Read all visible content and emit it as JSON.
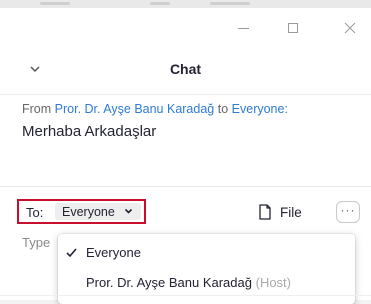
{
  "window": {
    "title": "Chat",
    "controls": [
      "minimize",
      "maximize",
      "close"
    ]
  },
  "message": {
    "prefix": "From",
    "sender": "Pror. Dr. Ayşe Banu Karadağ",
    "connector": "to",
    "recipient": "Everyone:",
    "text": "Merhaba Arkadaşlar"
  },
  "composer": {
    "to_label": "To:",
    "to_value": "Everyone",
    "file_label": "File",
    "more_label": "···",
    "placeholder": "Type"
  },
  "recipient_menu": {
    "items": [
      {
        "name": "Everyone",
        "checked": true,
        "suffix": ""
      },
      {
        "name": "Pror. Dr. Ayşe Banu Karadağ",
        "checked": false,
        "suffix": "(Host)"
      }
    ]
  },
  "colors": {
    "link": "#2d7bd6",
    "highlight_border": "#c8102e",
    "text": "#232333",
    "muted": "#a9a9a9"
  }
}
